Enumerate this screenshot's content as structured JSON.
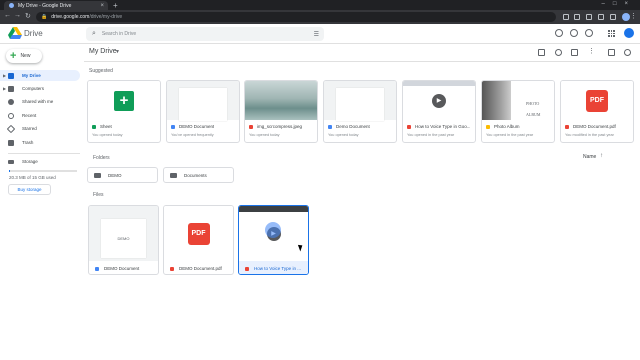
{
  "browser": {
    "tab_title": "My Drive - Google Drive",
    "new_tab_label": "+",
    "url_host": "drive.google.com",
    "url_path": "/drive/my-drive"
  },
  "app": {
    "name": "Drive",
    "search_placeholder": "Search in Drive"
  },
  "sidebar": {
    "new_label": "New",
    "items": [
      {
        "label": "My Drive",
        "active": true,
        "expandable": true
      },
      {
        "label": "Computers",
        "active": false,
        "expandable": true
      },
      {
        "label": "Shared with me",
        "active": false,
        "expandable": false
      },
      {
        "label": "Recent",
        "active": false,
        "expandable": false
      },
      {
        "label": "Starred",
        "active": false,
        "expandable": false
      },
      {
        "label": "Trash",
        "active": false,
        "expandable": false
      }
    ],
    "storage_label": "Storage",
    "storage_used": "20.3 MB of 15 GB used",
    "storage_fraction": 0.0014,
    "buy_storage": "Buy storage"
  },
  "main": {
    "title": "My Drive",
    "suggested_title": "Suggested",
    "folders_title": "Folders",
    "files_title": "Files",
    "sort_label": "Name",
    "sort_arrow": "↑",
    "suggested": [
      {
        "name": "Sheet",
        "sub": "You opened today",
        "kind": "sheet"
      },
      {
        "name": "DEMO Document",
        "sub": "You've opened frequently",
        "kind": "doc"
      },
      {
        "name": "img_scrcompress.jpeg",
        "sub": "You opened today",
        "kind": "image"
      },
      {
        "name": "Demo Document",
        "sub": "You opened today",
        "kind": "doc"
      },
      {
        "name": "How to Voice Type in Goo...",
        "sub": "You opened in the past year",
        "kind": "video"
      },
      {
        "name": "Photo Album",
        "sub": "You opened in the past year",
        "kind": "slides"
      },
      {
        "name": "DEMO Document.pdf",
        "sub": "You modified in the past year",
        "kind": "pdf"
      }
    ],
    "photo_album_words": [
      "PHOTO",
      "ALBUM"
    ],
    "folders": [
      {
        "name": "DEMO"
      },
      {
        "name": "Documents"
      }
    ],
    "files": [
      {
        "name": "DEMO Document",
        "kind": "doc",
        "thumb_text": "DEMO",
        "selected": false
      },
      {
        "name": "DEMO Document.pdf",
        "kind": "pdf",
        "thumb_text": "PDF",
        "selected": false
      },
      {
        "name": "How to Voice Type in ...",
        "kind": "video",
        "thumb_text": "",
        "selected": true
      }
    ],
    "pdf_badge_text": "PDF"
  },
  "colors": {
    "accent": "#1a73e8",
    "active_bg": "#e8f0fe",
    "pdf_red": "#ea4335",
    "sheet_green": "#0f9d58",
    "slides_yellow": "#fbbc04",
    "doc_blue": "#4285f4"
  }
}
